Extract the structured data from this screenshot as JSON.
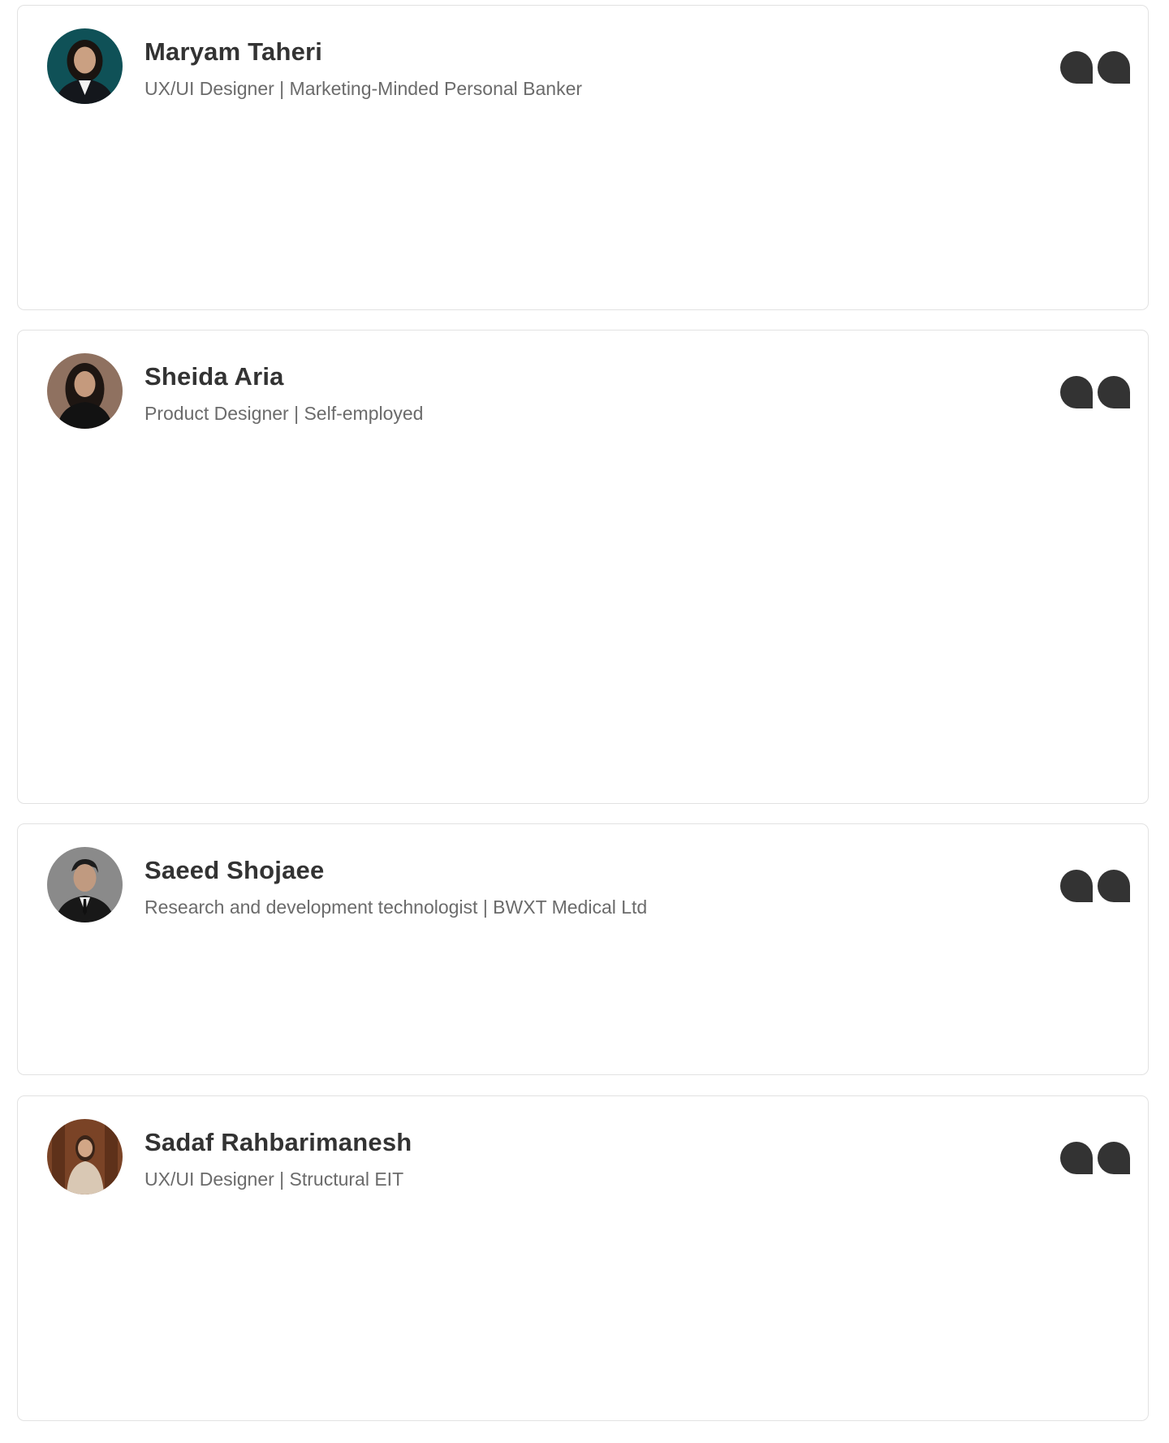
{
  "testimonials": [
    {
      "name": "Maryam Taheri",
      "headline": "UX/UI Designer | Marketing-Minded Personal Banker",
      "avatar_icon": "person-avatar-icon",
      "quote_icon": "quote-icon"
    },
    {
      "name": "Sheida Aria",
      "headline": "Product Designer | Self-employed",
      "avatar_icon": "person-avatar-icon",
      "quote_icon": "quote-icon"
    },
    {
      "name": "Saeed Shojaee",
      "headline": "Research and development technologist | BWXT Medical Ltd",
      "avatar_icon": "person-avatar-icon",
      "quote_icon": "quote-icon"
    },
    {
      "name": "Sadaf Rahbarimanesh",
      "headline": "UX/UI Designer | Structural EIT",
      "avatar_icon": "person-avatar-icon",
      "quote_icon": "quote-icon"
    }
  ],
  "colors": {
    "card_border": "#e2e2e2",
    "name_text": "#333333",
    "headline_text": "#6b6b6b",
    "quote_icon": "#333333"
  }
}
